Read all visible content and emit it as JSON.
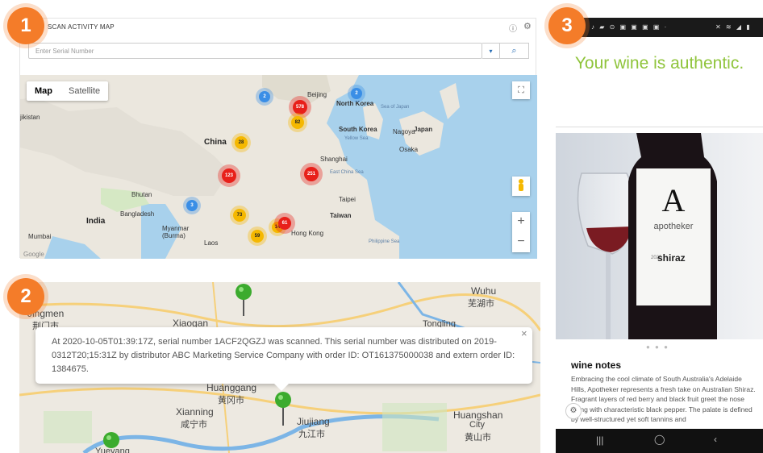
{
  "badges": [
    "1",
    "2",
    "3"
  ],
  "panel1": {
    "title": "SCAN ACTIVITY MAP",
    "search_placeholder": "Enter Serial Number",
    "map_type": {
      "map": "Map",
      "satellite": "Satellite"
    },
    "labels": {
      "china": "China",
      "india": "India",
      "north_korea": "North Korea",
      "south_korea": "South Korea",
      "japan": "Japan",
      "taiwan": "Taiwan",
      "myanmar": "Myanmar\n(Burma)",
      "laos": "Laos",
      "bangladesh": "Bangladesh",
      "bhutan": "Bhutan",
      "beijing": "Beijing",
      "shanghai": "Shanghai",
      "hong_kong": "Hong Kong",
      "taipei": "Taipei",
      "nagoya": "Nagoya",
      "osaka": "Osaka",
      "mumbai": "Mumbai",
      "jikistan": "jikistan",
      "sea_of_japan": "Sea of Japan",
      "yellow_sea": "Yellow Sea",
      "east_china_sea": "East China Sea",
      "philippine_sea": "Philippine Sea",
      "google": "Google"
    },
    "clusters": [
      "2",
      "578",
      "2",
      "82",
      "28",
      "123",
      "251",
      "3",
      "73",
      "14",
      "61",
      "59"
    ]
  },
  "panel2": {
    "popup": "At 2020-10-05T01:39:17Z, serial number 1ACF2QGZJ was scanned. This serial number was distributed on 2019-0312T20;15:31Z by distributor ABC Marketing Service Company with order ID: OT161375000038 and extern order ID: 1384675.",
    "labels": {
      "jingmen": "Jingmen",
      "jingmen_zh": "荆门市",
      "xiaogan": "Xiaogan",
      "wuhu": "Wuhu",
      "wuhu_zh": "芜湖市",
      "tongling": "Tongling",
      "huanggang": "Huanggang",
      "huanggang_zh": "黄冈市",
      "xianning": "Xianning",
      "xianning_zh": "咸宁市",
      "jiujiang": "Jiujiang",
      "jiujiang_zh": "九江市",
      "huangshan": "Huangshan",
      "huangshan_zh": "City",
      "huangshan_zh2": "黄山市",
      "yueyang": "Yueyang"
    }
  },
  "panel3": {
    "headline": "Your wine is authentic.",
    "brand_mark": "A",
    "brand": "apotheker",
    "wine": "shiraz",
    "wine_prefix": "2020",
    "section": "wine notes",
    "notes": "Embracing the cool climate of South Australia's Adelaide Hills, Apotheker represents a fresh take on Australian Shiraz. Fragrant layers of red berry and black fruit greet the nose along with characteristic black pepper. The palate is defined by well-structured yet soft tannins and"
  },
  "colors": {
    "accent": "#f47c29",
    "green": "#8fc43b",
    "link": "#2a6fb5"
  }
}
